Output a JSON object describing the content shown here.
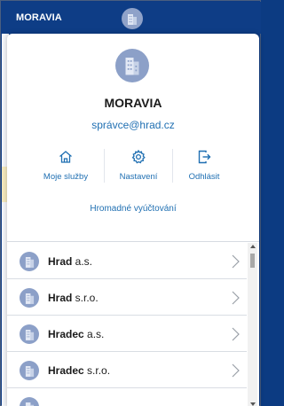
{
  "topbar": {
    "title": "MORAVIA",
    "avatar_icon": "building-icon"
  },
  "profile": {
    "avatar_icon": "building-icon",
    "name": "MORAVIA",
    "email": "správce@hrad.cz"
  },
  "actions": [
    {
      "icon": "home-icon",
      "label": "Moje služby"
    },
    {
      "icon": "gear-icon",
      "label": "Nastavení"
    },
    {
      "icon": "logout-icon",
      "label": "Odhlásit"
    }
  ],
  "billing_link": "Hromadné vyúčtování",
  "companies": [
    {
      "icon": "building-icon",
      "name_bold": "Hrad",
      "name_rest": " a.s."
    },
    {
      "icon": "building-icon",
      "name_bold": "Hrad",
      "name_rest": " s.r.o."
    },
    {
      "icon": "building-icon",
      "name_bold": "Hradec",
      "name_rest": " a.s."
    },
    {
      "icon": "building-icon",
      "name_bold": "Hradec",
      "name_rest": " s.r.o."
    },
    {
      "icon": "building-icon",
      "name_bold": "",
      "name_rest": ""
    }
  ],
  "colors": {
    "topbar": "#0e3d86",
    "link": "#1f6fb2",
    "avatar": "#8ca0c8"
  }
}
